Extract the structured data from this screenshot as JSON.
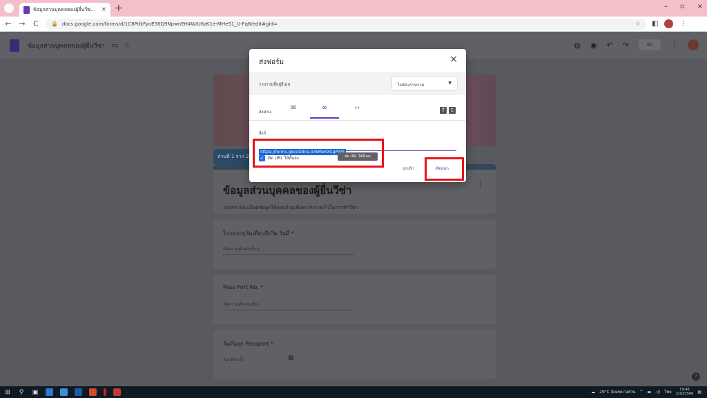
{
  "browser": {
    "tab_title": "ข้อมูลส่วนบุคคลของผู้ยื่นวีซ่า - Goog",
    "tab_close": "×",
    "new_tab": "+",
    "win_minimize": "–",
    "win_maximize": "▫",
    "win_close": "×",
    "url": "docs.google.com/forms/d/1C8PdkFyoE56Q9NpwnEH4W/U6zK1e-MHeS1_U-Fq8/edit#gid=",
    "back": "←",
    "forward": "→",
    "reload": "C"
  },
  "forms_header": {
    "doc_title": "ข้อมูลส่วนบุคคลของผู้ยื่นวีซ่า",
    "send_label": "ส่ง"
  },
  "form": {
    "section_tab": "ส่วนที่ 1 จาก 2",
    "title": "ข้อมูลส่วนบุคคลของผู้ยื่นวีซ่า",
    "description": "กรอกรายละเอียดข้อมูลให้ครบถ้วนเพื่อความรวดเร็วในการทำวีซ่า",
    "questions": [
      {
        "label": "โปรดระบุวันเดือนปีเกิด วันที่ *",
        "answer": "ข้อความคำตอบสั้นๆ"
      },
      {
        "label": "Pass Port No. *",
        "answer": "ข้อความคำตอบสั้นๆ"
      },
      {
        "label": "วันที่ออก Passport *",
        "answer": "วัน เดือน ปี"
      }
    ]
  },
  "dialog": {
    "title": "ส่งฟอร์ม",
    "close": "×",
    "collect_label": "รวบรวมที่อยู่อีเมล",
    "collect_value": "ไม่ต้องรวบรวม",
    "send_via_label": "ส่งผ่าน",
    "link_label": "ลิงก์",
    "link_value": "https://forms.gle/xD9rsL33kMeRXCgPW9",
    "shorten_label": "ตัด URL ให้สั้นลง",
    "tooltip": "ตัด URL ให้สั้นลง",
    "cancel_label": "ยกเลิก",
    "copy_label": "คัดลอก"
  },
  "taskbar": {
    "weather": "29°C มีเมฆบางส่วน",
    "lang": "ไทย",
    "time": "19:46",
    "date": "2/10/2566"
  },
  "colors": {
    "accent": "#673ab7",
    "highlight": "#e8101c",
    "tab_strip": "#f3c0c9"
  }
}
